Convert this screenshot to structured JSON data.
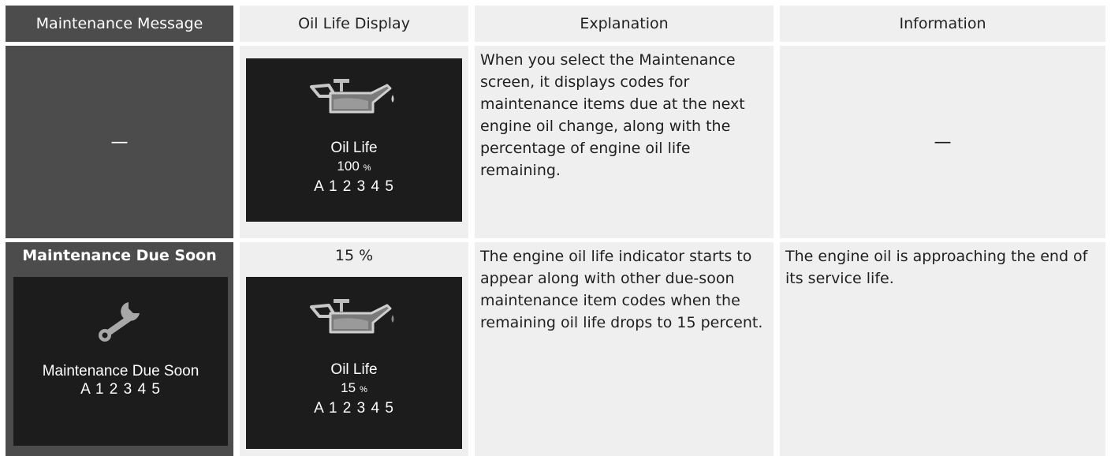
{
  "headers": [
    "Maintenance Message",
    "Oil Life Display",
    "Explanation",
    "Information"
  ],
  "row1": {
    "message": "—",
    "display": {
      "label": "Oil Life",
      "percent": "100",
      "unit": "%",
      "codes": "A 1 2 3 4 5",
      "icon": "oil-can-icon"
    },
    "explanation": "When you select the Maintenance screen, it displays codes for maintenance items due at the next engine oil change, along with the percentage of engine oil life remaining.",
    "information": "—"
  },
  "row2": {
    "message_title": "Maintenance Due Soon",
    "message_display": {
      "label": "Maintenance Due Soon",
      "codes": "A 1 2 3 4 5",
      "icon": "wrench-icon"
    },
    "display_caption": "15 %",
    "display": {
      "label": "Oil Life",
      "percent": "15",
      "unit": "%",
      "codes": "A 1 2 3 4 5",
      "icon": "oil-can-icon"
    },
    "explanation": "The engine oil life indicator starts to appear along with other due-soon maintenance item codes when the remaining oil life drops to 15 percent.",
    "information": "The engine oil is approaching the end of its service life."
  },
  "colors": {
    "header_dark": "#4c4c4c",
    "cell_light": "#efefef",
    "panel_bg": "#1c1c1c"
  }
}
